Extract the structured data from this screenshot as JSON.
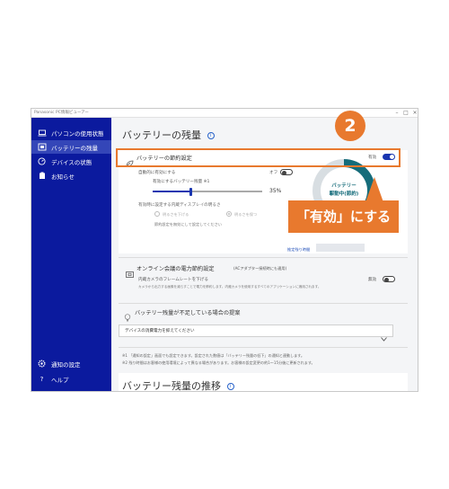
{
  "app": {
    "title": "Panasonic PC情報ビューアー",
    "window_controls": [
      "–",
      "□",
      "×"
    ]
  },
  "sidebar": {
    "items": [
      {
        "label": "パソコンの使用状態",
        "icon": "laptop-icon",
        "active": false
      },
      {
        "label": "バッテリーの残量",
        "icon": "battery-monitor-icon",
        "active": true
      },
      {
        "label": "デバイスの状態",
        "icon": "device-status-icon",
        "active": false
      },
      {
        "label": "お知らせ",
        "icon": "notice-icon",
        "active": false
      }
    ],
    "bottom_items": [
      {
        "label": "通知の設定",
        "icon": "gear-icon"
      },
      {
        "label": "ヘルプ",
        "icon": "help-icon"
      }
    ]
  },
  "main": {
    "page_title": "バッテリーの残量",
    "saving": {
      "header": "バッテリーの節約設定",
      "status_text": "有効",
      "enabled": true,
      "auto_enable_label": "自動的に有効にする",
      "auto_enable_state": "オフ",
      "auto_enable_on": false,
      "threshold_label": "有効にするバッテリー残量 ※1",
      "threshold_value": "35%",
      "threshold_fraction": 0.35,
      "brightness_label": "有効時に設定する内蔵ディスプレイの明るさ",
      "radio_a": "明るさを下げる",
      "radio_b": "明るさを保つ",
      "radio_hint": "節約設定を無効にして設定してください",
      "gauge_line1": "バッテリー",
      "gauge_line2": "駆動中(節約)",
      "remaining_label": "推定残り時間"
    },
    "online": {
      "header": "オンライン会議の電力節約設定",
      "header_note": "(ACアダプター接続時にも適用)",
      "item_label": "内蔵カメラのフレームレートを下げる",
      "item_desc": "カメラから出力する画像を減らすことで電力を節約します。内蔵カメラを使用するすべてのアプリケーションに適用されます。",
      "state_text": "無効",
      "enabled": false
    },
    "suggestion": {
      "header": "バッテリー残量が不足している場合の提案",
      "dropdown_value": "デバイスの消費電力を抑えてください"
    },
    "notes": [
      "※1 「通知の設定」画面でも設定できます。設定された数値は「バッテリー残量の低下」の通知と連動します。",
      "※2 残り時間はお客様の使用環境によって異なる場合があります。お客様の設定変更の約1～15分後に更新されます。"
    ],
    "next_section_title": "バッテリー残量の推移"
  },
  "annotation": {
    "step_number": "2",
    "callout_text": "「有効」にする",
    "accent_color": "#e8792e"
  },
  "colors": {
    "sidebar_bg": "#0b1a9e",
    "sidebar_active": "#3446b8",
    "toggle_on": "#1a36b0",
    "gauge_teal": "#166c7a"
  }
}
